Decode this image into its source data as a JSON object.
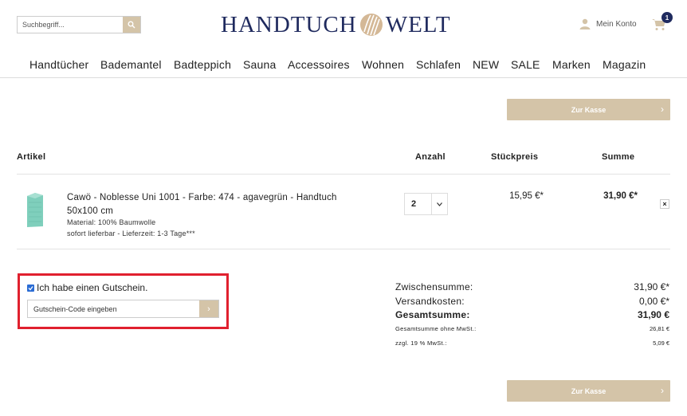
{
  "header": {
    "search_placeholder": "Suchbegriff...",
    "logo_left": "HANDTUCH",
    "logo_right": "WELT",
    "account_label": "Mein Konto",
    "cart_count": "1"
  },
  "nav": {
    "items": [
      "Handtücher",
      "Bademantel",
      "Badteppich",
      "Sauna",
      "Accessoires",
      "Wohnen",
      "Schlafen",
      "NEW",
      "SALE",
      "Marken",
      "Magazin"
    ]
  },
  "checkout_button": "Zur Kasse",
  "checkout_chevron": "›",
  "table": {
    "headers": {
      "article": "Artikel",
      "quantity": "Anzahl",
      "unit_price": "Stückpreis",
      "total": "Summe"
    }
  },
  "item": {
    "name": "Cawö - Noblesse Uni 1001 - Farbe: 474 - agavegrün - Handtuch 50x100 cm",
    "material": "Material: 100% Baumwolle",
    "delivery": "sofort lieferbar - Lieferzeit: 1-3 Tage***",
    "quantity": "2",
    "unit_price": "15,95 €*",
    "total": "31,90 €*",
    "remove": "×",
    "color": "#7fcfbc"
  },
  "voucher": {
    "label": "Ich habe einen Gutschein.",
    "checked": true,
    "placeholder": "Gutschein-Code eingeben",
    "submit": "›"
  },
  "totals": {
    "subtotal_label": "Zwischensumme:",
    "subtotal": "31,90 €*",
    "shipping_label": "Versandkosten:",
    "shipping": "0,00 €*",
    "grand_label": "Gesamtsumme:",
    "grand": "31,90 €",
    "net_label": "Gesamtsumme ohne MwSt.:",
    "net": "26,81 €",
    "vat_label": "zzgl. 19 % MwSt.:",
    "vat": "5,09 €"
  },
  "colors": {
    "brand": "#1f2a5e",
    "accent": "#d4c4a8",
    "highlight": "#e0202e"
  }
}
